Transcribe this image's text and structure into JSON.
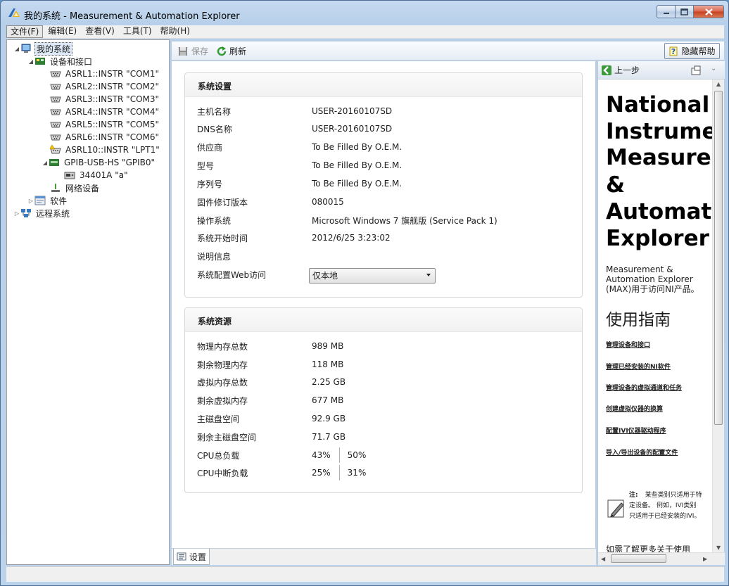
{
  "window": {
    "title": "我的系统 - Measurement & Automation Explorer"
  },
  "menu": [
    "文件(F)",
    "编辑(E)",
    "查看(V)",
    "工具(T)",
    "帮助(H)"
  ],
  "tree": {
    "my_system": "我的系统",
    "devices": "设备和接口",
    "asrl1": "ASRL1::INSTR \"COM1\"",
    "asrl2": "ASRL2::INSTR \"COM2\"",
    "asrl3": "ASRL3::INSTR \"COM3\"",
    "asrl4": "ASRL4::INSTR \"COM4\"",
    "asrl5": "ASRL5::INSTR \"COM5\"",
    "asrl6": "ASRL6::INSTR \"COM6\"",
    "asrl10": "ASRL10::INSTR \"LPT1\"",
    "gpib": "GPIB-USB-HS \"GPIB0\"",
    "instr": "34401A \"a\"",
    "network": "网络设备",
    "software": "软件",
    "remote": "远程系统"
  },
  "toolbar": {
    "save": "保存",
    "refresh": "刷新",
    "hide_help": "隐藏帮助"
  },
  "settings": {
    "title": "系统设置",
    "rows": [
      {
        "k": "主机名称",
        "v": "USER-20160107SD"
      },
      {
        "k": "DNS名称",
        "v": "USER-20160107SD"
      },
      {
        "k": "供应商",
        "v": "To Be Filled By O.E.M."
      },
      {
        "k": "型号",
        "v": "To Be Filled By O.E.M."
      },
      {
        "k": "序列号",
        "v": "To Be Filled By O.E.M."
      },
      {
        "k": "固件修订版本",
        "v": "080015"
      },
      {
        "k": "操作系统",
        "v": "Microsoft Windows 7 旗舰版  (Service Pack 1)"
      },
      {
        "k": "系统开始时间",
        "v": "2012/6/25 3:23:02"
      },
      {
        "k": "说明信息",
        "v": ""
      },
      {
        "k": "系统配置Web访问",
        "v": ""
      }
    ],
    "web_access_value": "仅本地"
  },
  "resources": {
    "title": "系统资源",
    "rows": [
      {
        "k": "物理内存总数",
        "v": "989 MB"
      },
      {
        "k": "剩余物理内存",
        "v": "118 MB"
      },
      {
        "k": "虚拟内存总数",
        "v": "2.25 GB"
      },
      {
        "k": "剩余虚拟内存",
        "v": "677 MB"
      },
      {
        "k": "主磁盘空间",
        "v": "92.9 GB"
      },
      {
        "k": "剩余主磁盘空间",
        "v": "71.7 GB"
      }
    ],
    "cpu_load_label": "CPU总负载",
    "cpu_load_1": "43%",
    "cpu_load_2": "50%",
    "cpu_int_label": "CPU中断负载",
    "cpu_int_1": "25%",
    "cpu_int_2": "31%"
  },
  "tabs": {
    "settings": "设置"
  },
  "help": {
    "back": "上一步",
    "title_lines": [
      "National",
      "Instrume",
      "Measure",
      "&",
      "Automat",
      "Explorer"
    ],
    "desc": "Measurement & Automation Explorer (MAX)用于访问NI产品。",
    "guide": "使用指南",
    "links": [
      "管理设备和接口",
      "管理已经安装的NI软件",
      "管理设备的虚拟通道和任务",
      "创建虚拟仪器的换算",
      "配置IVI仪器驱动程序",
      "导入/导出设备的配置文件"
    ],
    "note_label": "注:",
    "note_text": "某些类别只适用于特定设备。 例如，IVI类别只适用于已经安装的IVI。",
    "more_text": "如需了解更多关于使用MAX的信息，可从帮助菜单中选择相应的帮助主"
  }
}
